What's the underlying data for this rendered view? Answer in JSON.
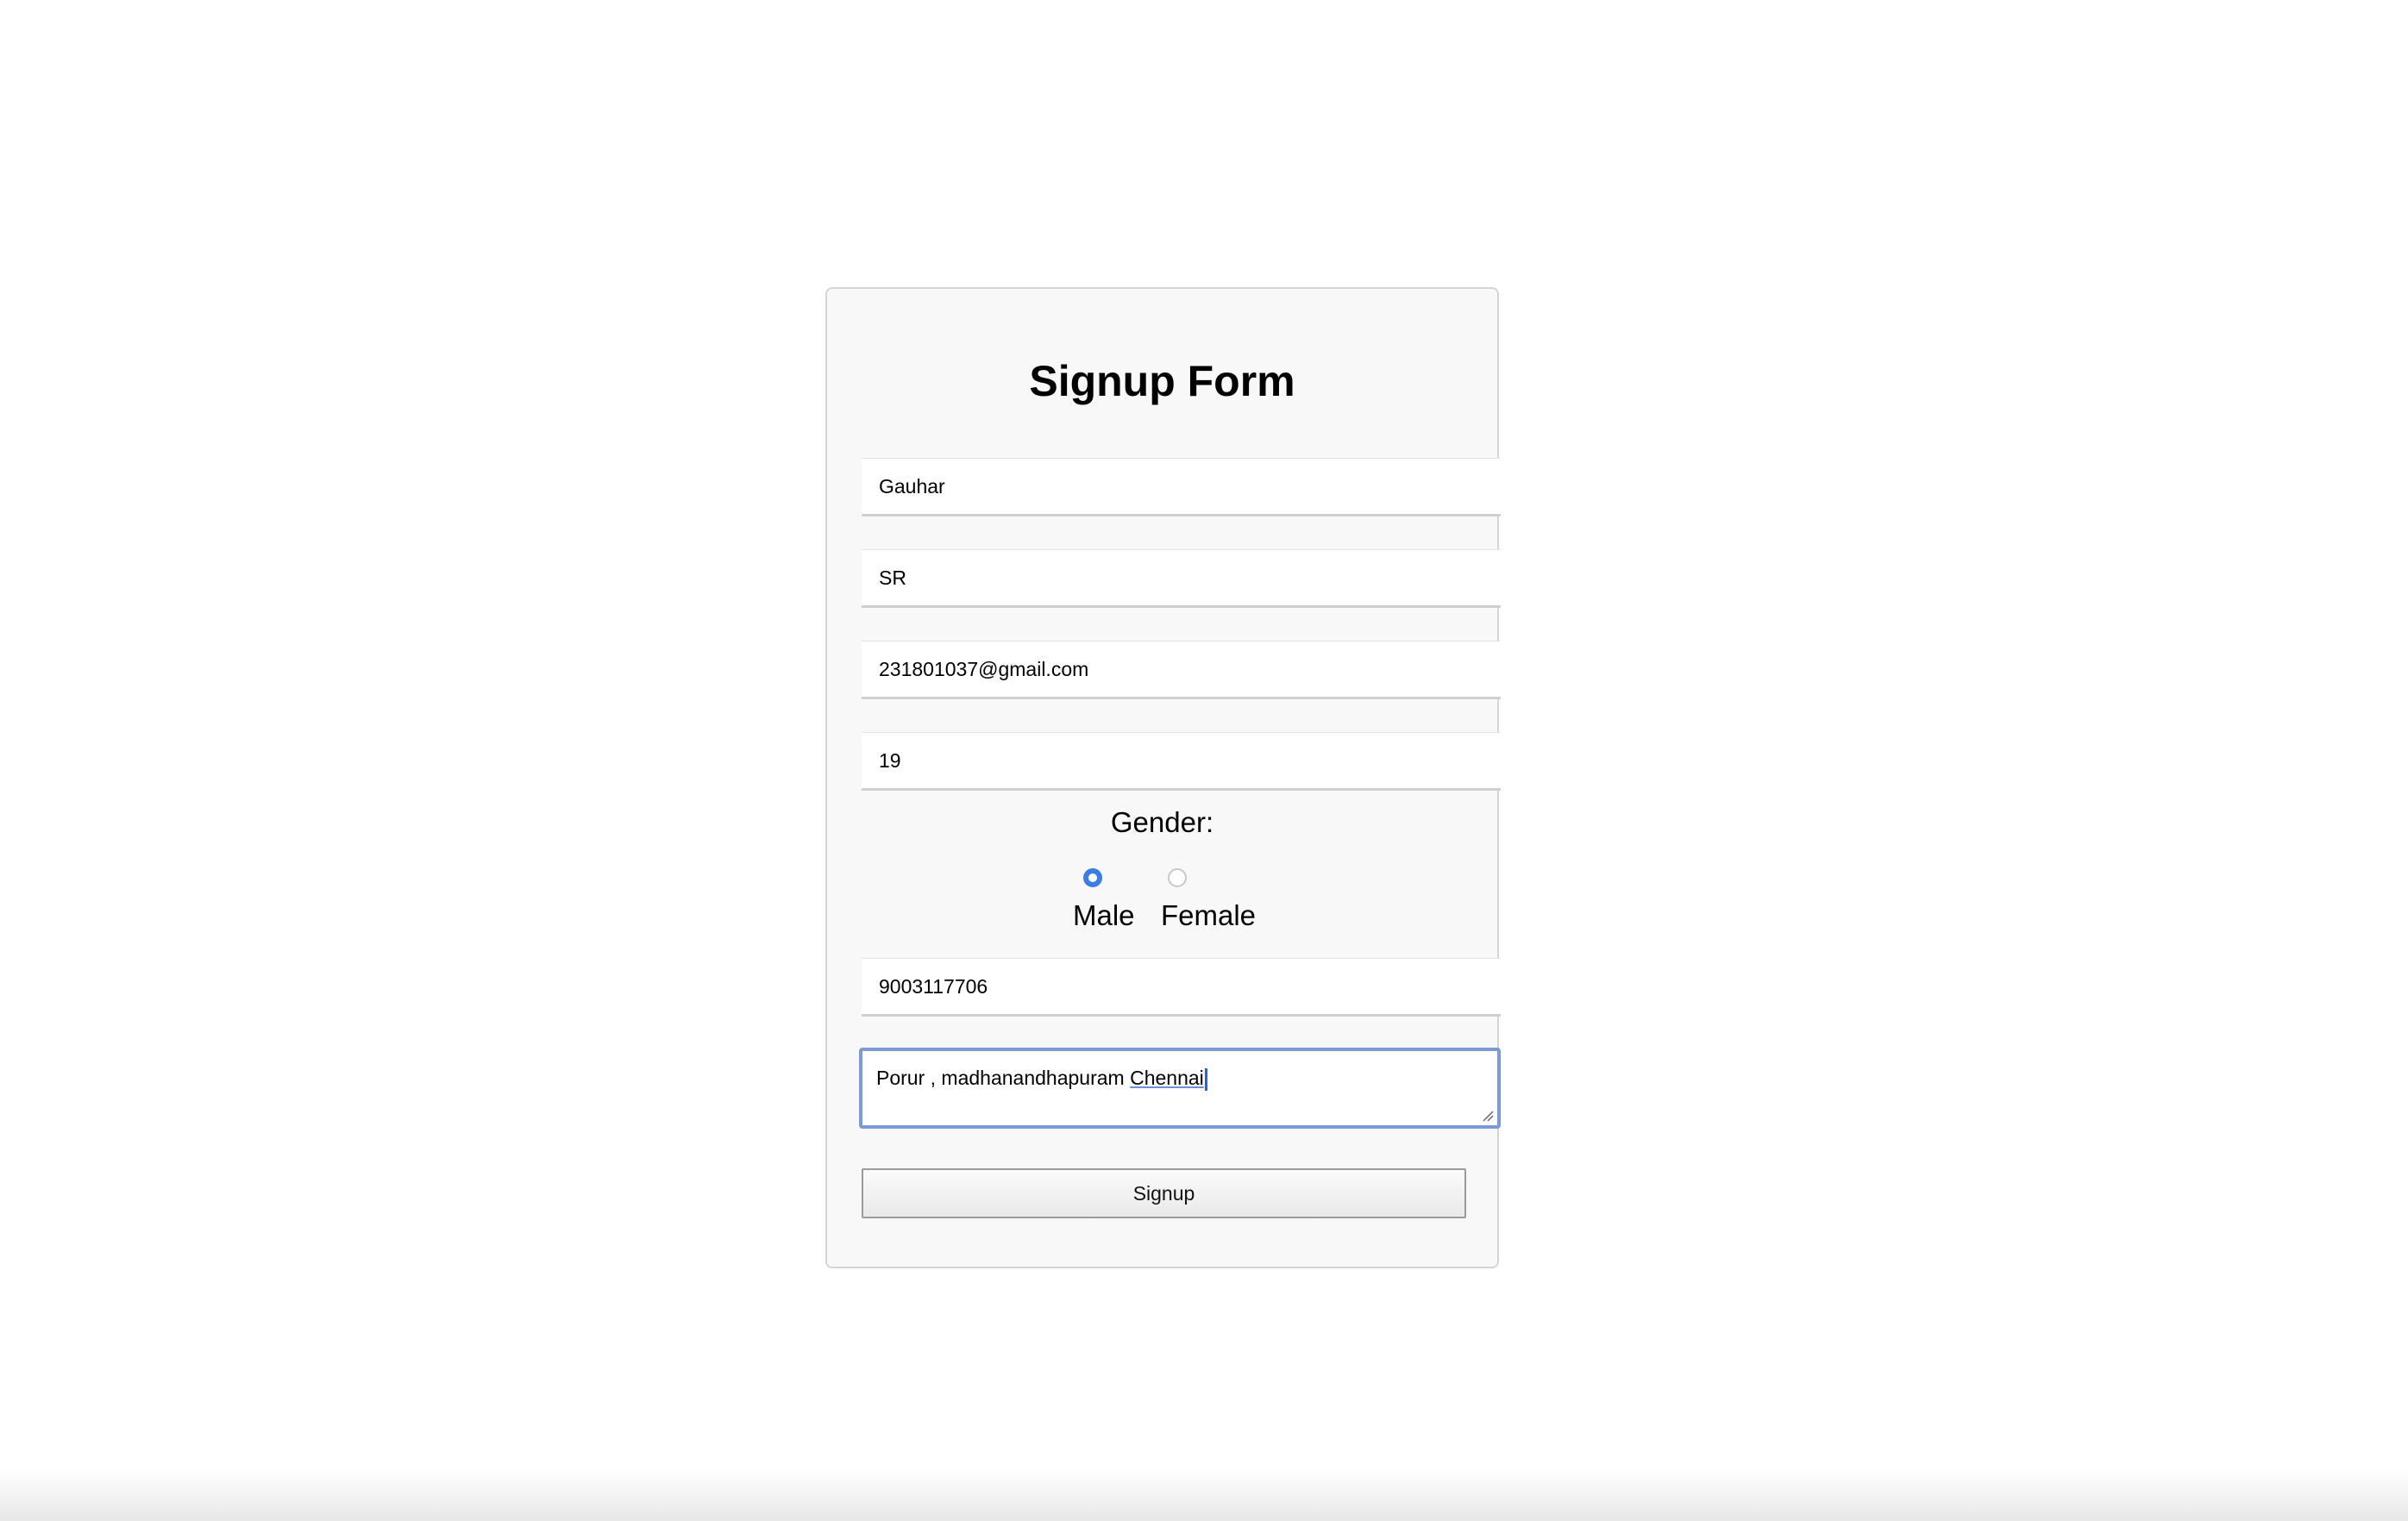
{
  "form": {
    "title": "Signup Form",
    "first_name": "Gauhar",
    "last_name": "SR",
    "email": "231801037@gmail.com",
    "age": "19",
    "gender_label": "Gender:",
    "gender_options": [
      {
        "label": "Male",
        "checked": true
      },
      {
        "label": "Female",
        "checked": false
      }
    ],
    "phone": "9003117706",
    "address_part1": "Porur , madhanandhapuram ",
    "address_part2": "Chennai",
    "submit_label": "Signup"
  },
  "colors": {
    "accent": "#3b7de8",
    "focus_border": "#7b9ad8",
    "card_background": "#f8f8f8"
  }
}
